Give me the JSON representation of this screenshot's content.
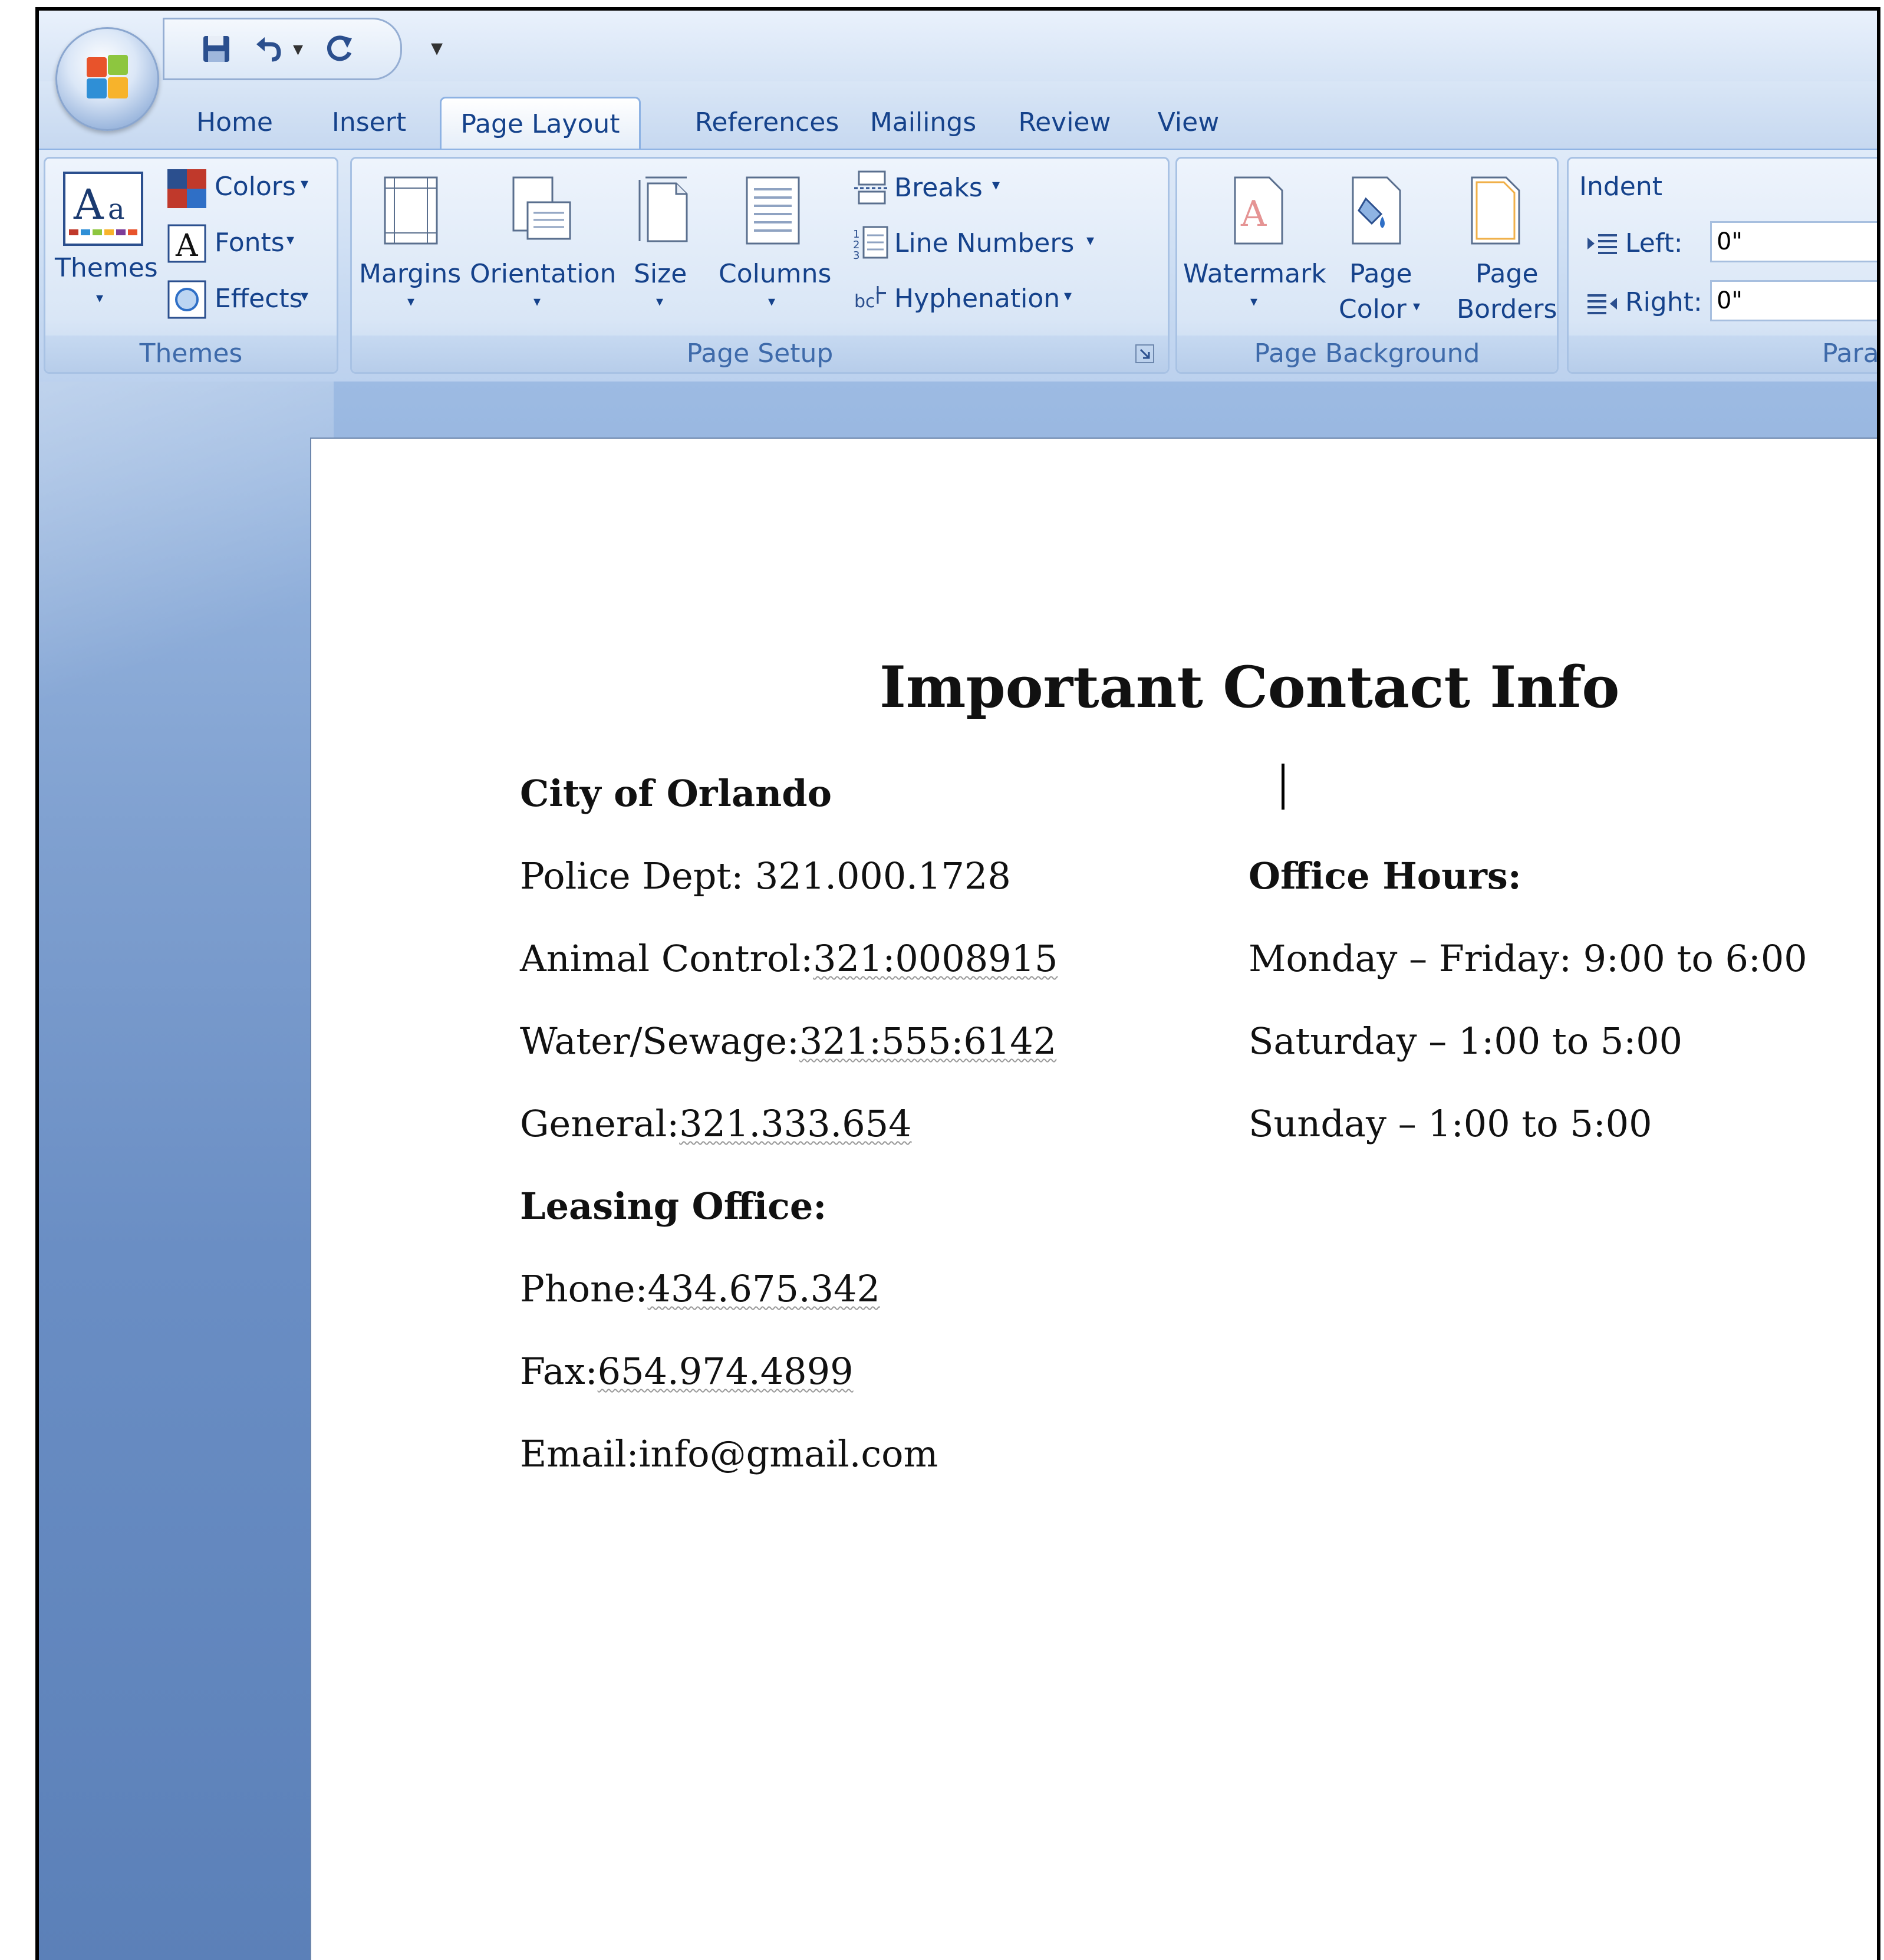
{
  "qat": {
    "save_icon": "save-icon",
    "undo_icon": "undo-icon",
    "redo_icon": "redo-icon",
    "customize": "▾"
  },
  "tabs": [
    {
      "label": "Home"
    },
    {
      "label": "Insert"
    },
    {
      "label": "Page Layout",
      "active": true
    },
    {
      "label": "References"
    },
    {
      "label": "Mailings"
    },
    {
      "label": "Review"
    },
    {
      "label": "View"
    }
  ],
  "ribbon": {
    "themes_group": {
      "label": "Themes",
      "themes_button": "Themes",
      "colors": "Colors",
      "fonts": "Fonts",
      "effects": "Effects"
    },
    "page_setup_group": {
      "label": "Page Setup",
      "margins": "Margins",
      "orientation": "Orientation",
      "size": "Size",
      "columns": "Columns",
      "breaks": "Breaks",
      "line_numbers": "Line Numbers",
      "hyphenation": "Hyphenation"
    },
    "page_background_group": {
      "label": "Page Background",
      "watermark": "Watermark",
      "page_color_1": "Page",
      "page_color_2": "Color",
      "page_borders_1": "Page",
      "page_borders_2": "Borders"
    },
    "paragraph_group": {
      "label": "Paragra",
      "indent": "Indent",
      "left_label": "Left:",
      "left_value": "0\"",
      "right_label": "Right:",
      "right_value": "0\""
    }
  },
  "document": {
    "title": "Important Contact Info",
    "left_column": [
      {
        "text": "City of Orlando",
        "bold": true
      },
      {
        "prefix": "Police Dept: ",
        "value": "321.000.1728",
        "squiggle": false
      },
      {
        "prefix": "Animal Control:",
        "value": "321:0008915",
        "squiggle": true
      },
      {
        "prefix": "Water/Sewage:",
        "value": "321:555:6142",
        "squiggle": true
      },
      {
        "prefix": "General:",
        "value": "321.333.654",
        "squiggle": true
      },
      {
        "text": "Leasing Office:",
        "bold": true
      },
      {
        "prefix": "Phone:",
        "value": "434.675.342",
        "squiggle": true
      },
      {
        "prefix": "Fax:",
        "value": "654.974.4899",
        "squiggle": true
      },
      {
        "prefix": "Email:",
        "value": "info@gmail.com",
        "squiggle": false
      }
    ],
    "right_column": [
      {
        "text": "Office Hours:",
        "bold": true
      },
      {
        "text": "Monday – Friday: 9:00 to 6:00"
      },
      {
        "text": "Saturday – 1:00 to 5:00"
      },
      {
        "text": "Sunday – 1:00 to 5:00"
      }
    ]
  }
}
